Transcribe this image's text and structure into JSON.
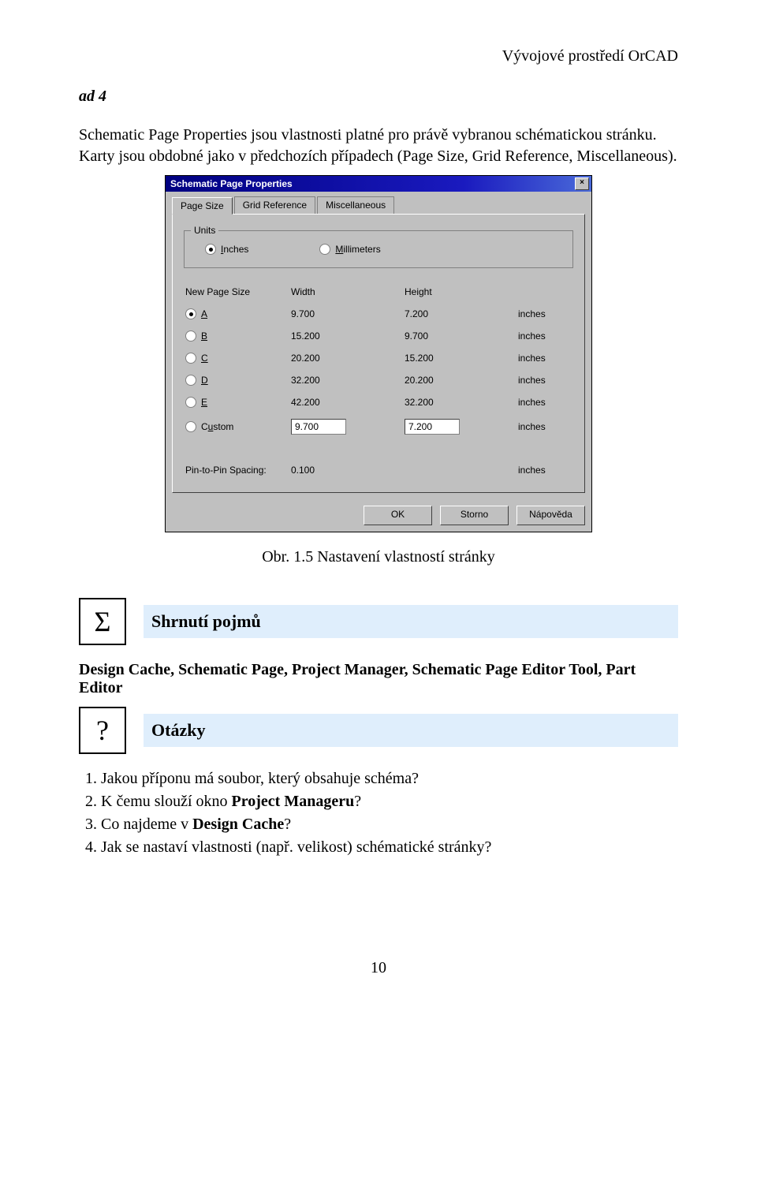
{
  "header": {
    "right": "Vývojové prostředí OrCAD"
  },
  "section_label": "ad 4",
  "intro_para": "Schematic Page Properties jsou vlastnosti platné pro právě vybranou schématickou stránku. Karty jsou obdobné jako v předchozích případech (Page Size, Grid Reference, Miscellaneous).",
  "dialog": {
    "title": "Schematic Page Properties",
    "tabs": [
      "Page Size",
      "Grid Reference",
      "Miscellaneous"
    ],
    "units_group": "Units",
    "units": {
      "inches": "Inches",
      "mm": "Millimeters"
    },
    "cols": {
      "label": "New Page Size",
      "width": "Width",
      "height": "Height"
    },
    "rows": [
      {
        "name": "A",
        "w": "9.700",
        "h": "7.200",
        "u": "inches",
        "selected": true
      },
      {
        "name": "B",
        "w": "15.200",
        "h": "9.700",
        "u": "inches"
      },
      {
        "name": "C",
        "w": "20.200",
        "h": "15.200",
        "u": "inches"
      },
      {
        "name": "D",
        "w": "32.200",
        "h": "20.200",
        "u": "inches"
      },
      {
        "name": "E",
        "w": "42.200",
        "h": "32.200",
        "u": "inches"
      },
      {
        "name": "Custom",
        "w": "9.700",
        "h": "7.200",
        "u": "inches",
        "input": true
      }
    ],
    "pin_label": "Pin-to-Pin Spacing:",
    "pin_value": "0.100",
    "pin_unit": "inches",
    "buttons": {
      "ok": "OK",
      "cancel": "Storno",
      "help": "Nápověda"
    },
    "close": "×"
  },
  "caption": "Obr. 1.5   Nastavení vlastností stránky",
  "summary": {
    "sigma": "Σ",
    "heading": "Shrnutí pojmů",
    "terms": "Design Cache, Schematic Page, Project Manager, Schematic Page Editor Tool, Part Editor"
  },
  "questions_block": {
    "qmark": "?",
    "heading": "Otázky",
    "items": [
      "Jakou příponu má soubor, který obsahuje schéma?",
      "K čemu slouží okno Project Manageru?",
      "Co najdeme v Design Cache?",
      "Jak se nastaví vlastnosti (např. velikost) schématické stránky?"
    ],
    "bold_terms": {
      "1": "Project Manageru",
      "2": "Design Cache"
    }
  },
  "page_number": "10"
}
